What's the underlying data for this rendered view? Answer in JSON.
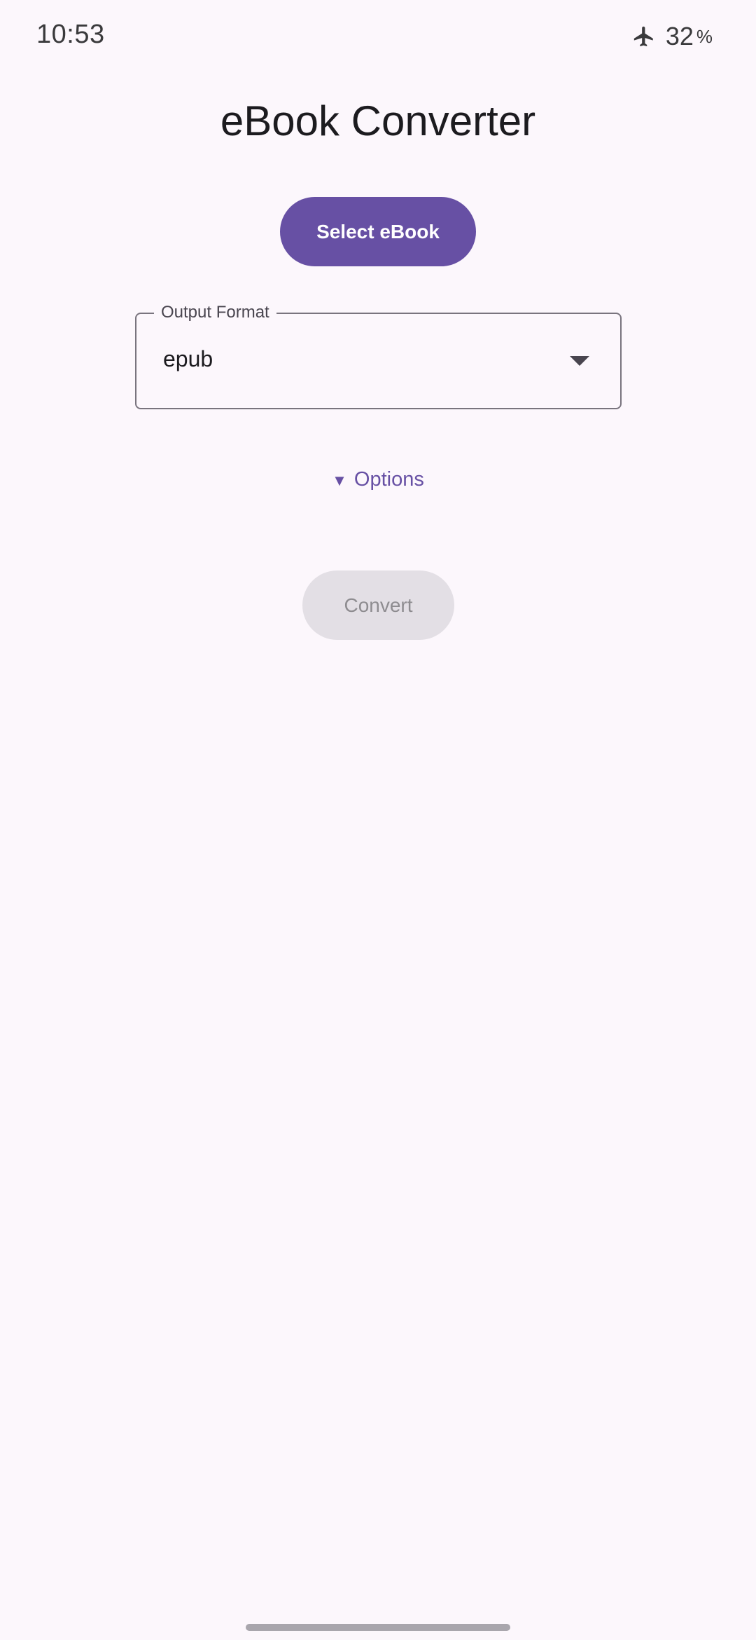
{
  "status_bar": {
    "time": "10:53",
    "battery": "32",
    "battery_unit": "%",
    "airplane_icon": "airplane-mode-icon"
  },
  "app": {
    "title": "eBook Converter"
  },
  "select_button": {
    "label": "Select eBook"
  },
  "output_format": {
    "label": "Output Format",
    "value": "epub"
  },
  "options": {
    "arrow": "▼",
    "label": "Options"
  },
  "convert_button": {
    "label": "Convert",
    "enabled": false
  },
  "colors": {
    "primary": "#6750a4",
    "background": "#fcf7fc",
    "disabled_bg": "#e3dfe5",
    "disabled_text": "#8e8c90"
  }
}
